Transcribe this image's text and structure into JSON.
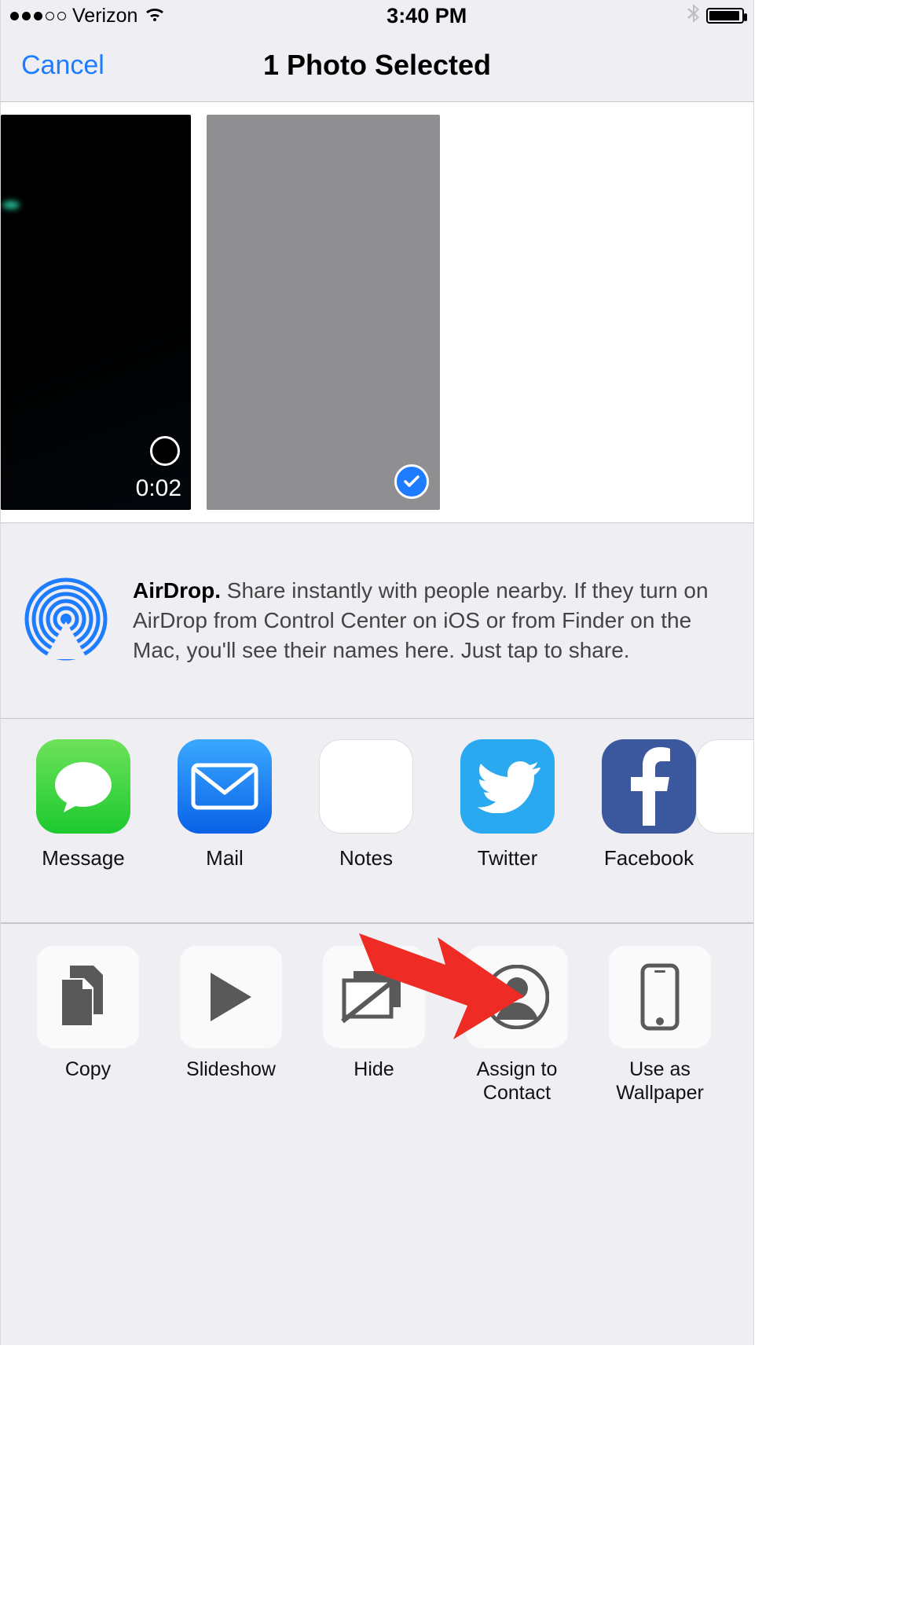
{
  "status": {
    "carrier": "Verizon",
    "time": "3:40 PM"
  },
  "header": {
    "cancel": "Cancel",
    "title": "1 Photo Selected"
  },
  "media": {
    "video_duration": "0:02"
  },
  "airdrop": {
    "bold": "AirDrop.",
    "text": " Share instantly with people nearby. If they turn on AirDrop from Control Center on iOS or from Finder on the Mac, you'll see their names here. Just tap to share."
  },
  "apps": {
    "message": "Message",
    "mail": "Mail",
    "notes": "Notes",
    "twitter": "Twitter",
    "facebook": "Facebook"
  },
  "actions": {
    "copy": "Copy",
    "slideshow": "Slideshow",
    "hide": "Hide",
    "assign": "Assign to Contact",
    "wallpaper": "Use as Wallpaper"
  }
}
